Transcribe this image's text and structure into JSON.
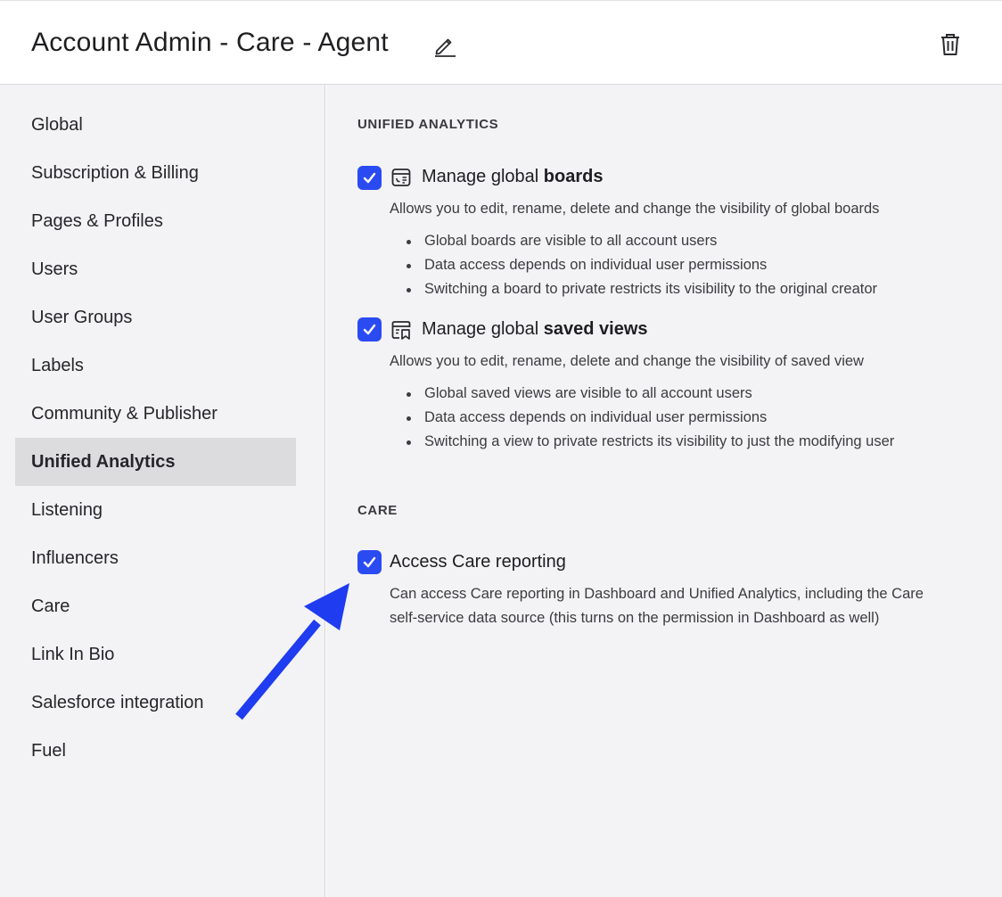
{
  "header": {
    "title": "Account Admin - Care - Agent"
  },
  "sidebar": {
    "items": [
      {
        "label": "Global"
      },
      {
        "label": "Subscription & Billing"
      },
      {
        "label": "Pages & Profiles"
      },
      {
        "label": "Users"
      },
      {
        "label": "User Groups"
      },
      {
        "label": "Labels"
      },
      {
        "label": "Community & Publisher"
      },
      {
        "label": "Unified Analytics",
        "active": true
      },
      {
        "label": "Listening"
      },
      {
        "label": "Influencers"
      },
      {
        "label": "Care"
      },
      {
        "label": "Link In Bio"
      },
      {
        "label": "Salesforce integration"
      },
      {
        "label": "Fuel"
      }
    ]
  },
  "main": {
    "sections": [
      {
        "title": "UNIFIED ANALYTICS",
        "permissions": [
          {
            "icon": "board-icon",
            "checked": true,
            "title_prefix": "Manage global ",
            "title_bold": "boards",
            "description": "Allows you to edit, rename, delete and change the visibility of global boards",
            "bullets": [
              "Global boards are visible to all account users",
              "Data access depends on individual user permissions",
              "Switching a board to private restricts its visibility to the original creator"
            ]
          },
          {
            "icon": "saved-view-icon",
            "checked": true,
            "title_prefix": "Manage global ",
            "title_bold": "saved views",
            "description": "Allows you to edit, rename, delete and change the visibility of saved view",
            "bullets": [
              "Global saved views are visible to all account users",
              "Data access depends on individual user permissions",
              "Switching a view to private restricts its visibility to just the modifying user"
            ]
          }
        ]
      },
      {
        "title": "CARE",
        "permissions": [
          {
            "checked": true,
            "title": "Access Care reporting",
            "description_line1": "Can access Care reporting in Dashboard and Unified Analytics, including the Care",
            "description_line2": "self-service data source (this turns on the permission in Dashboard as well)"
          }
        ]
      }
    ]
  },
  "colors": {
    "accent": "#2b4bf2",
    "arrow": "#1f3cf0",
    "sidebar_active": "#dcdcdf",
    "background": "#f3f3f5"
  }
}
